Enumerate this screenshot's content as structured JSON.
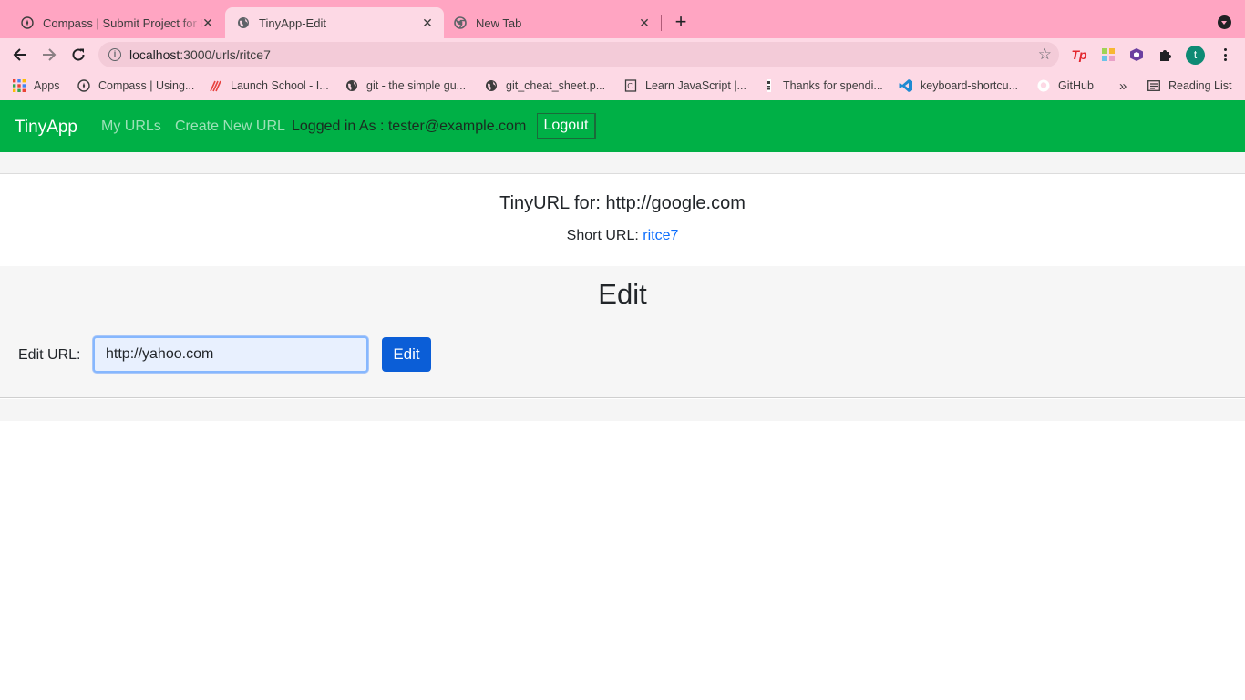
{
  "browser": {
    "tabs": [
      {
        "title": "Compass | Submit Project for E",
        "icon": "compass-icon"
      },
      {
        "title": "TinyApp-Edit",
        "icon": "globe-icon"
      },
      {
        "title": "New Tab",
        "icon": "chrome-icon"
      }
    ],
    "active_tab": 1,
    "address": {
      "host": "localhost",
      "path": ":3000/urls/ritce7"
    },
    "bookmarks": [
      {
        "label": "Apps",
        "icon": "apps-grid-icon"
      },
      {
        "label": "Compass | Using...",
        "icon": "compass-icon"
      },
      {
        "label": "Launch School - I...",
        "icon": "launch-school-icon"
      },
      {
        "label": "git - the simple gu...",
        "icon": "globe-icon"
      },
      {
        "label": "git_cheat_sheet.p...",
        "icon": "globe-icon"
      },
      {
        "label": "Learn JavaScript |...",
        "icon": "document-icon"
      },
      {
        "label": "Thanks for spendi...",
        "icon": "bookmark-page-icon"
      },
      {
        "label": "keyboard-shortcu...",
        "icon": "vscode-icon"
      },
      {
        "label": "GitHub",
        "icon": "github-icon"
      }
    ],
    "more_bookmarks": "»",
    "reading_list": "Reading List",
    "profile_initial": "t",
    "colors": {
      "frame": "#ffa5c2",
      "toolbar": "#fdd9e5"
    }
  },
  "navbar": {
    "brand": "TinyApp",
    "links": [
      "My URLs",
      "Create New URL"
    ],
    "logged_in_text": "Logged in As : tester@example.com",
    "logout_label": "Logout",
    "color": "#00b046"
  },
  "main": {
    "heading": "TinyURL for: http://google.com",
    "short_url_label": "Short URL: ",
    "short_url_value": "ritce7"
  },
  "edit": {
    "title": "Edit",
    "label": "Edit URL:",
    "input_value": "http://yahoo.com",
    "button_label": "Edit",
    "button_color": "#0b5ed7"
  }
}
